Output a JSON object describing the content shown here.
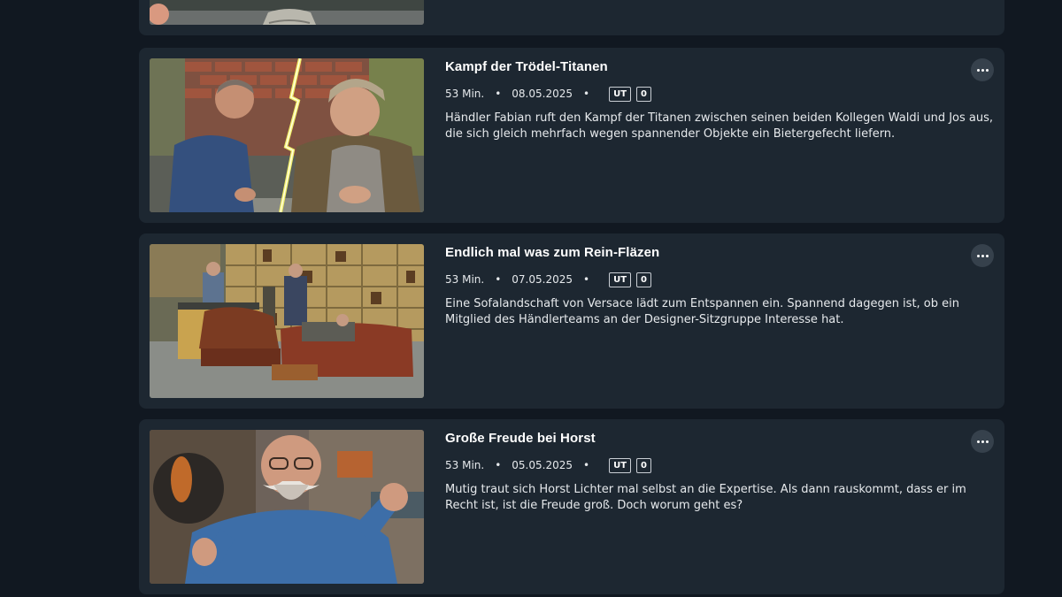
{
  "episodes": [
    {
      "title": "",
      "duration": "",
      "date": "",
      "badges": [],
      "description": ""
    },
    {
      "title": "Kampf der Trödel-Titanen",
      "duration": "53 Min.",
      "date": "08.05.2025",
      "badges": [
        "UT",
        "0"
      ],
      "description": "Händler Fabian ruft den Kampf der Titanen zwischen seinen beiden Kollegen Waldi und Jos aus, die sich gleich mehrfach wegen spannender Objekte ein Bietergefecht liefern."
    },
    {
      "title": "Endlich mal was zum Rein-Fläzen",
      "duration": "53 Min.",
      "date": "07.05.2025",
      "badges": [
        "UT",
        "0"
      ],
      "description": "Eine Sofalandschaft von Versace lädt zum Entspannen ein. Spannend dagegen ist, ob ein Mitglied des Händlerteams an der Designer-Sitzgruppe Interesse hat."
    },
    {
      "title": "Große Freude bei Horst",
      "duration": "53 Min.",
      "date": "05.05.2025",
      "badges": [
        "UT",
        "0"
      ],
      "description": "Mutig traut sich Horst Lichter mal selbst an die Expertise. Als dann rauskommt, dass er im Recht ist, ist die Freude groß. Doch worum geht es?"
    }
  ],
  "separator": "•",
  "icons": {
    "more": "more-options-icon"
  },
  "colors": {
    "page_background": "#111821",
    "card_background": "#1d2731",
    "more_button": "#36414c",
    "text": "#ffffff"
  }
}
